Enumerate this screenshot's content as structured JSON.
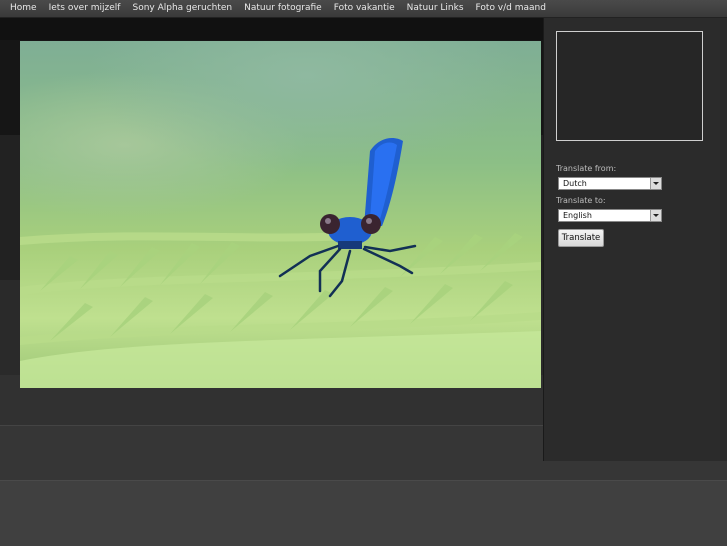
{
  "nav": {
    "items": [
      {
        "label": "Home"
      },
      {
        "label": "Iets over mijzelf"
      },
      {
        "label": "Sony Alpha geruchten"
      },
      {
        "label": "Natuur fotografie"
      },
      {
        "label": "Foto vakantie"
      },
      {
        "label": "Natuur Links"
      },
      {
        "label": "Foto v/d maand"
      }
    ]
  },
  "photo": {
    "subject": "blue damselfly on fern"
  },
  "translate": {
    "from_label": "Translate from:",
    "from_value": "Dutch",
    "to_label": "Translate to:",
    "to_value": "English",
    "button_label": "Translate"
  },
  "colors": {
    "navbar": "#3f3f3f",
    "sidebar": "#2b2b2b",
    "damselfly": "#1f5fd0"
  }
}
